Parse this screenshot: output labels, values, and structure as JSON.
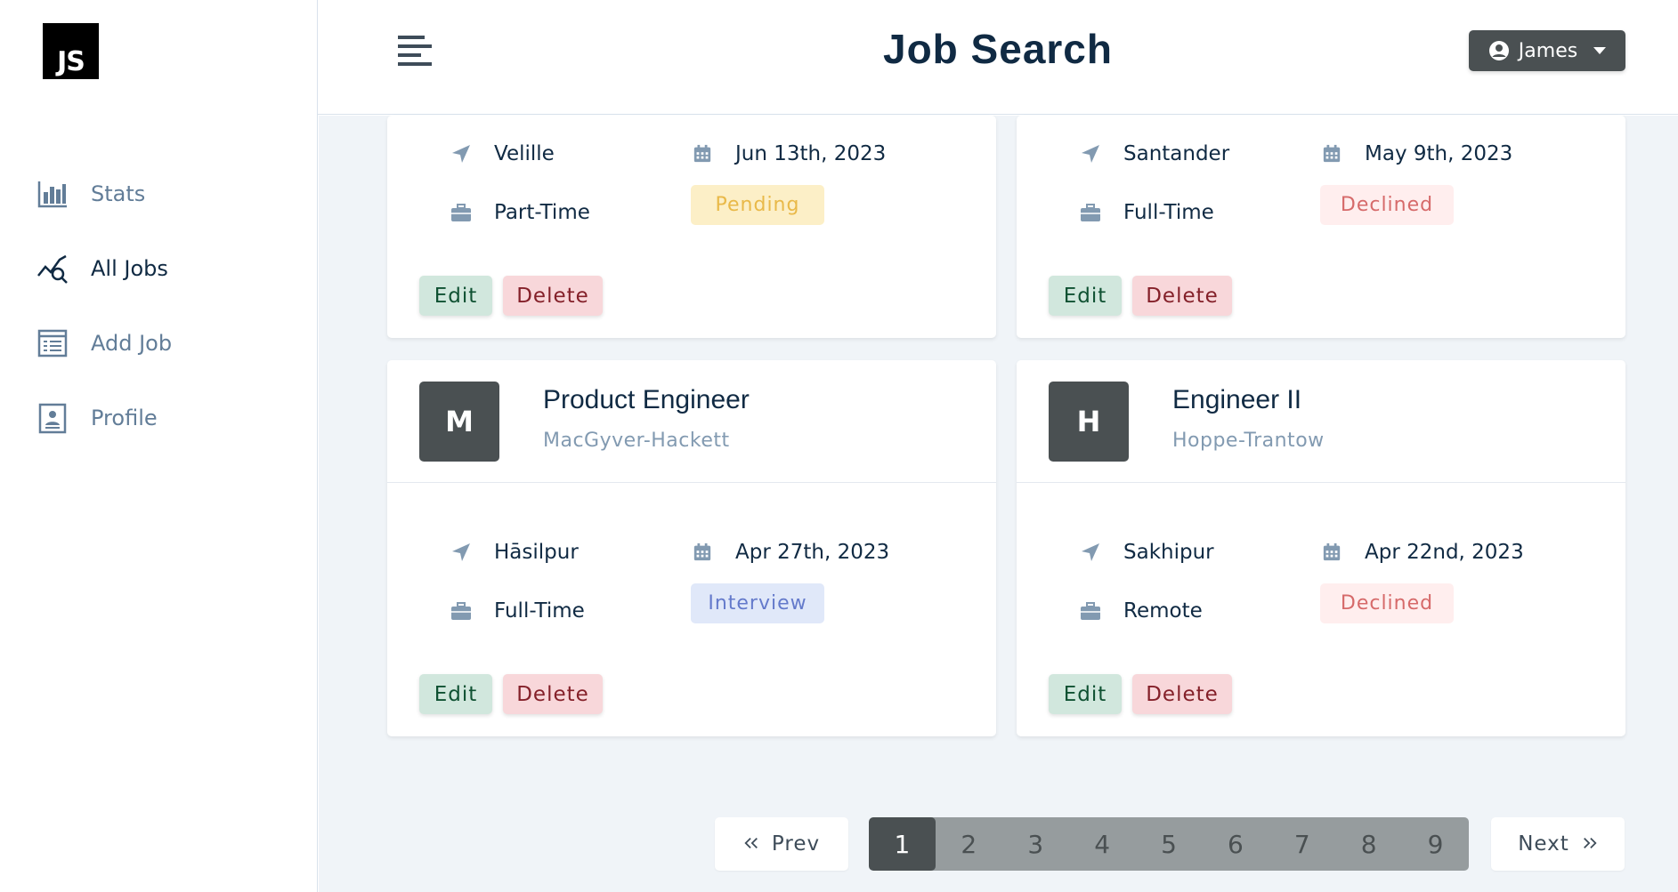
{
  "logo": {
    "text": "JS"
  },
  "header": {
    "title": "Job Search",
    "user_name": "James"
  },
  "sidebar": {
    "items": [
      {
        "label": "Stats",
        "icon": "bar-chart-icon",
        "active": false
      },
      {
        "label": "All Jobs",
        "icon": "search-trend-icon",
        "active": true
      },
      {
        "label": "Add Job",
        "icon": "form-icon",
        "active": false
      },
      {
        "label": "Profile",
        "icon": "profile-card-icon",
        "active": false
      }
    ]
  },
  "jobs": [
    {
      "location": "Velille",
      "date": "Jun 13th, 2023",
      "type": "Part-Time",
      "status": "Pending",
      "edit": "Edit",
      "delete": "Delete"
    },
    {
      "location": "Santander",
      "date": "May 9th, 2023",
      "type": "Full-Time",
      "status": "Declined",
      "edit": "Edit",
      "delete": "Delete"
    },
    {
      "avatar": "M",
      "position": "Product Engineer",
      "company": "MacGyver-Hackett",
      "location": "Hāsilpur",
      "date": "Apr 27th, 2023",
      "type": "Full-Time",
      "status": "Interview",
      "edit": "Edit",
      "delete": "Delete"
    },
    {
      "avatar": "H",
      "position": "Engineer II",
      "company": "Hoppe-Trantow",
      "location": "Sakhipur",
      "date": "Apr 22nd, 2023",
      "type": "Remote",
      "status": "Declined",
      "edit": "Edit",
      "delete": "Delete"
    }
  ],
  "pagination": {
    "prev": "Prev",
    "next": "Next",
    "pages": [
      "1",
      "2",
      "3",
      "4",
      "5",
      "6",
      "7",
      "8",
      "9"
    ],
    "current": "1"
  },
  "colors": {
    "accent_dark": "#4a5052",
    "background": "#f0f4f8",
    "pending": "#e9b949",
    "declined": "#d66a6a",
    "interview": "#647acb"
  }
}
